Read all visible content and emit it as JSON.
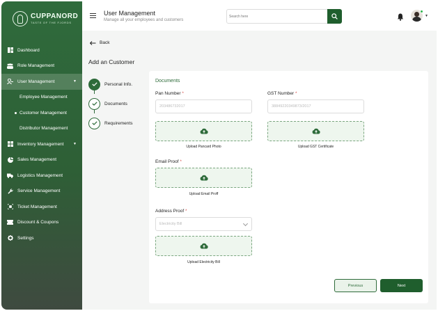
{
  "brand": {
    "name": "CUPPANORD",
    "tagline": "TASTE OF THE FJORDS"
  },
  "sidebar": {
    "items": [
      {
        "label": "Dashboard",
        "icon": "dashboard-icon"
      },
      {
        "label": "Role Management",
        "icon": "role-icon"
      },
      {
        "label": "User Management",
        "icon": "user-icon",
        "active": true
      },
      {
        "label": "Inventory Management",
        "icon": "inventory-icon"
      },
      {
        "label": "Sales Management",
        "icon": "sales-icon"
      },
      {
        "label": "Logistics Management",
        "icon": "truck-icon"
      },
      {
        "label": "Service Management",
        "icon": "wrench-icon"
      },
      {
        "label": "Ticket Management",
        "icon": "ticket-icon"
      },
      {
        "label": "Discount & Coupons",
        "icon": "coupon-icon"
      },
      {
        "label": "Settings",
        "icon": "gear-icon"
      }
    ],
    "sub_items": [
      {
        "label": "Employee Management"
      },
      {
        "label": "Customer Management",
        "active": true
      },
      {
        "label": "Distributor Management"
      }
    ]
  },
  "header": {
    "title": "User Management",
    "subtitle": "Manage all your employees and customers",
    "search_placeholder": "Search here"
  },
  "page": {
    "back_label": "Back",
    "title": "Add an Customer",
    "steps": [
      {
        "label": "Personal Info.",
        "state": "done"
      },
      {
        "label": "Documents",
        "state": "current"
      },
      {
        "label": "Requirements",
        "state": "pending"
      }
    ]
  },
  "form": {
    "section_title": "Documents",
    "pan_label": "Pan Number",
    "pan_value": "203486732017",
    "gst_label": "GST Number",
    "gst_value": "38849220349873/2017",
    "required_mark": "*",
    "upload_pan": "Upload Pancard Photo",
    "upload_gst": "Upload GST Certificate",
    "email_label": "Email Proof",
    "upload_email": "Upload Email Proff",
    "address_label": "Address Proof",
    "address_select": "Electricity Bill",
    "upload_address": "Upload Electricity Bill"
  },
  "buttons": {
    "previous": "Previous",
    "next": "Next"
  },
  "colors": {
    "brand_green": "#1f5e2d",
    "accent_green": "#2e6b3a",
    "required": "#d9534f"
  }
}
